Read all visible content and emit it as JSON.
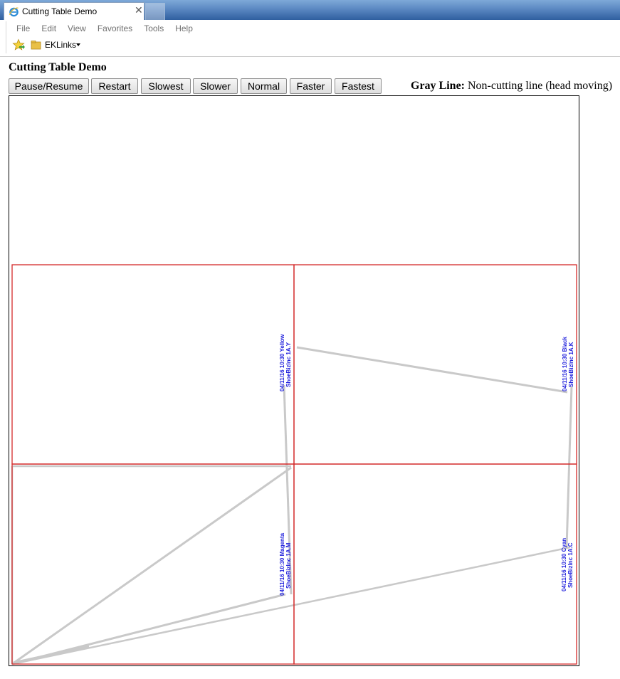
{
  "browser": {
    "tab_title": "Cutting Table Demo",
    "close_glyph": "✕",
    "menu": [
      "File",
      "Edit",
      "View",
      "Favorites",
      "Tools",
      "Help"
    ],
    "favorites": {
      "folder_label": "EKLinks"
    }
  },
  "page": {
    "title": "Cutting Table Demo",
    "buttons": [
      {
        "id": "pause-resume",
        "label": "Pause/Resume"
      },
      {
        "id": "restart",
        "label": "Restart"
      },
      {
        "id": "slowest",
        "label": "Slowest"
      },
      {
        "id": "slower",
        "label": "Slower"
      },
      {
        "id": "normal",
        "label": "Normal"
      },
      {
        "id": "faster",
        "label": "Faster"
      },
      {
        "id": "fastest",
        "label": "Fastest"
      }
    ],
    "legend": {
      "term": "Gray Line:",
      "description": "Non-cutting line (head moving)"
    }
  },
  "colors": {
    "panel_border": "#d42a2a",
    "move_line": "#c9c9c9",
    "label_text": "#1f1fdc",
    "canvas_border": "#000000"
  },
  "labels": [
    {
      "id": "yellow",
      "line1": "04/11/16  10:30  Yellow",
      "line2": "ShoeBizInc 1A.Y"
    },
    {
      "id": "black",
      "line1": "04/11/16  10:30  Black",
      "line2": "ShoeBizInc 1A.K"
    },
    {
      "id": "magenta",
      "line1": "04/11/16  10:30  Magenta",
      "line2": "ShoeBizInc 1A.M"
    },
    {
      "id": "cyan",
      "line1": "04/11/16  10:30  Cyan",
      "line2": "ShoeBizInc 1A.C"
    }
  ]
}
